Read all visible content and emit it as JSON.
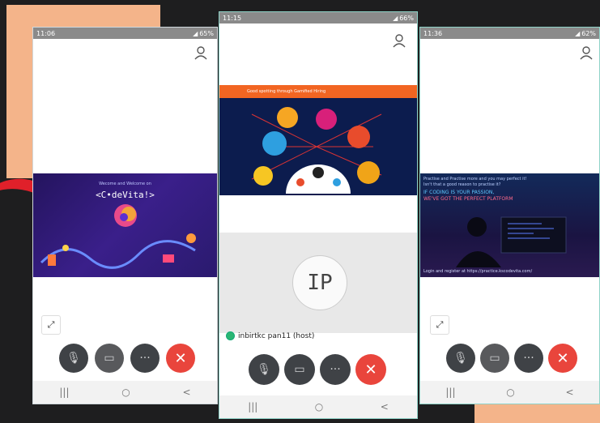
{
  "phones": [
    {
      "time": "11:06",
      "battery": "65%",
      "banner": {
        "kicker": "Wecome and Welcome on",
        "title": "<C•deVita!>"
      }
    },
    {
      "time": "11:15",
      "battery": "66%",
      "banner": {
        "header": "Good spotting through Gamified Hiring",
        "logos": [
          "InfoEdge",
          "Dare2Compete",
          "Cocubes",
          "EngiHA",
          "Platfm",
          "CodeVita"
        ]
      },
      "participant": {
        "initials": "IP",
        "name": "inbirtkc pan11 (host)"
      }
    },
    {
      "time": "11:36",
      "battery": "62%",
      "banner": {
        "line1": "Practise and Practise more and you may perfect it!",
        "line2": "Isn't that a good reason to practise it?",
        "line3": "IF CODING IS YOUR PASSION,",
        "line4": "WE'VE GOT THE PERFECT PLATFORM",
        "footer": "Login and register at https://practice.kscodevita.com/"
      }
    }
  ],
  "controls": {
    "more_label": "···",
    "end_label": "✕"
  },
  "nav": {
    "recent": "|||",
    "home": "○",
    "back": "<"
  },
  "colors": {
    "peach": "#f4b48a",
    "end_button": "#e9453c",
    "teal_border": "#8fd3c8"
  }
}
